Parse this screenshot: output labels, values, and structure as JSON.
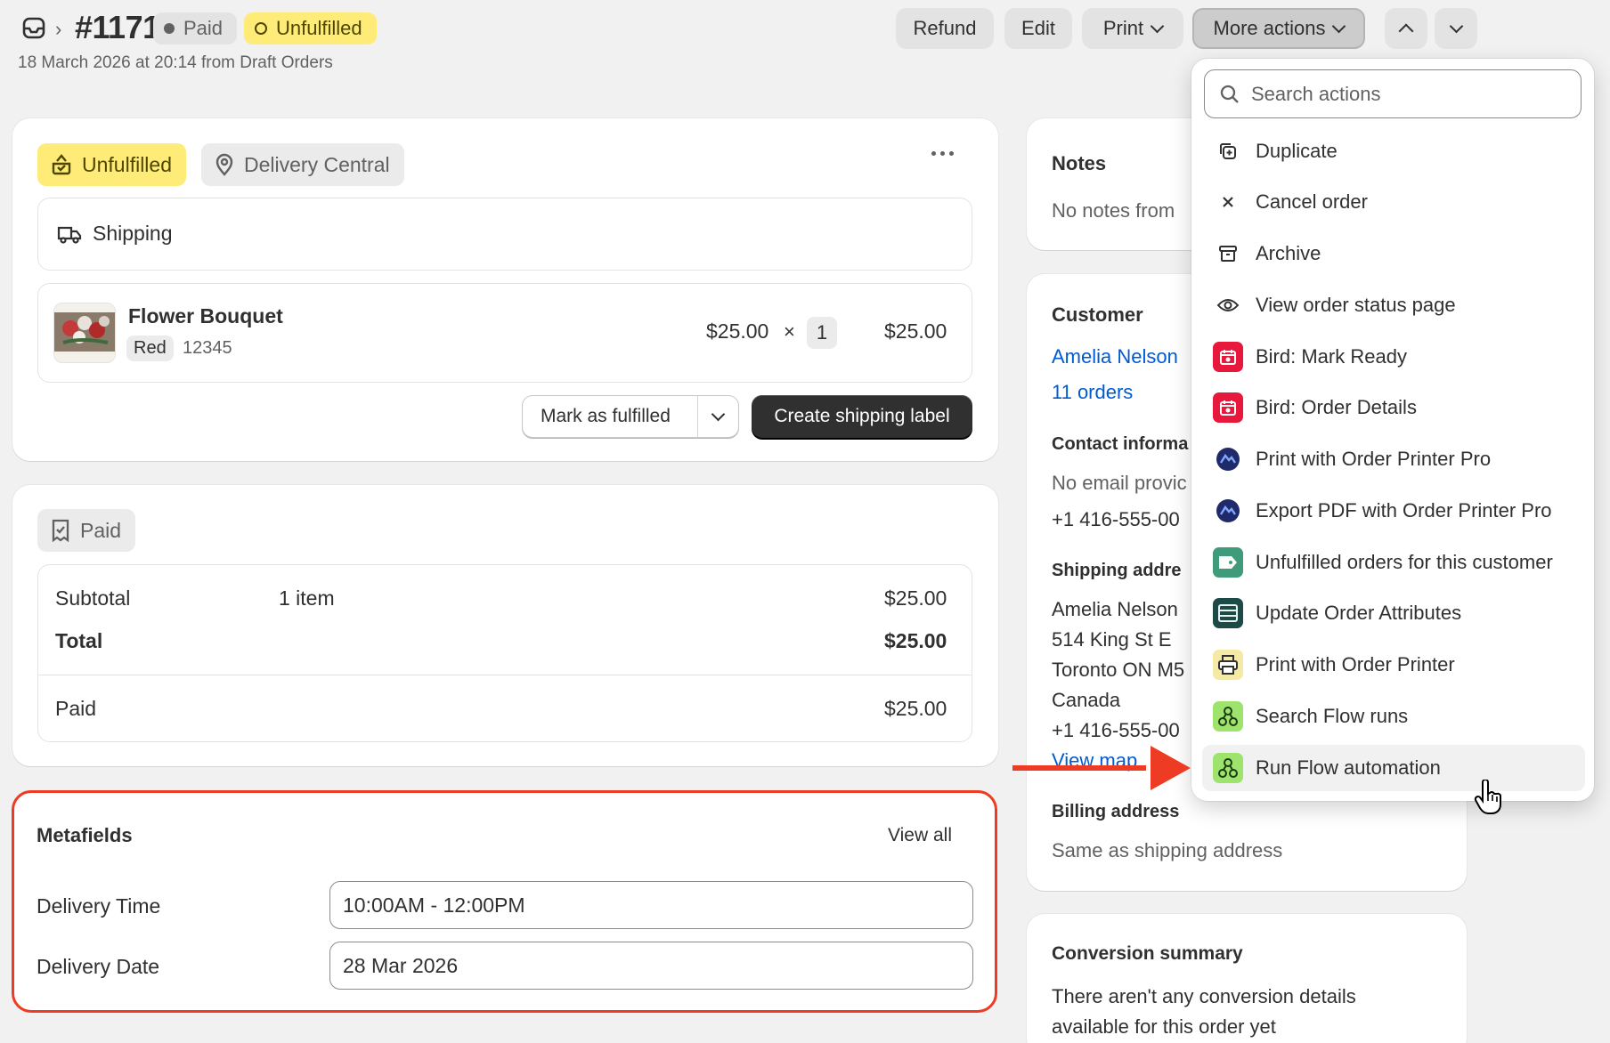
{
  "header": {
    "order_number": "#1171",
    "paid_badge": "Paid",
    "unfulfilled_badge": "Unfulfilled",
    "subline": "18 March 2026 at 20:14 from Draft Orders",
    "buttons": {
      "refund": "Refund",
      "edit": "Edit",
      "print": "Print",
      "more_actions": "More actions"
    }
  },
  "fulfillment": {
    "status": "Unfulfilled",
    "location": "Delivery Central",
    "method": "Shipping",
    "item": {
      "name": "Flower Bouquet",
      "variant": "Red",
      "sku": "12345",
      "unit_price": "$25.00",
      "times": "×",
      "quantity": "1",
      "total": "$25.00"
    },
    "mark_fulfilled": "Mark as fulfilled",
    "create_label": "Create shipping label"
  },
  "payment": {
    "status": "Paid",
    "subtotal_label": "Subtotal",
    "subtotal_items": "1 item",
    "subtotal_value": "$25.00",
    "total_label": "Total",
    "total_value": "$25.00",
    "paid_label": "Paid",
    "paid_value": "$25.00"
  },
  "metafields": {
    "title": "Metafields",
    "view_all": "View all",
    "delivery_time_label": "Delivery Time",
    "delivery_time_value": "10:00AM - 12:00PM",
    "delivery_date_label": "Delivery Date",
    "delivery_date_value": "28 Mar 2026"
  },
  "notes": {
    "title": "Notes",
    "text": "No notes from"
  },
  "customer": {
    "title": "Customer",
    "name": "Amelia Nelson",
    "orders": "11 orders",
    "contact_title": "Contact informa",
    "email": "No email provic",
    "phone": "+1 416-555-00",
    "shipping_title": "Shipping addre",
    "address_lines": [
      "Amelia Nelson",
      "514 King St E",
      "Toronto ON M5",
      "Canada",
      "+1 416-555-00"
    ],
    "view_map": "View map",
    "billing_title": "Billing address",
    "billing_text": "Same as shipping address"
  },
  "conversion": {
    "title": "Conversion summary",
    "line1": "There aren't any conversion details",
    "line2": "available for this order yet"
  },
  "menu": {
    "search_placeholder": "Search actions",
    "items": [
      {
        "label": "Duplicate",
        "icon": "duplicate-icon"
      },
      {
        "label": "Cancel order",
        "icon": "close-icon"
      },
      {
        "label": "Archive",
        "icon": "archive-icon"
      },
      {
        "label": "View order status page",
        "icon": "eye-icon"
      },
      {
        "label": "Bird: Mark Ready",
        "icon": "bird-app-icon"
      },
      {
        "label": "Bird: Order Details",
        "icon": "bird-app-icon"
      },
      {
        "label": "Print with Order Printer Pro",
        "icon": "order-printer-pro-icon"
      },
      {
        "label": "Export PDF with Order Printer Pro",
        "icon": "order-printer-pro-icon"
      },
      {
        "label": "Unfulfilled orders for this customer",
        "icon": "tag-app-icon"
      },
      {
        "label": "Update Order Attributes",
        "icon": "attributes-app-icon"
      },
      {
        "label": "Print with Order Printer",
        "icon": "printer-app-icon"
      },
      {
        "label": "Search Flow runs",
        "icon": "flow-icon"
      },
      {
        "label": "Run Flow automation",
        "icon": "flow-icon"
      }
    ]
  },
  "colors": {
    "highlight": "#ee3b23",
    "unfulfilled_bg": "#ffeb78",
    "link": "#005bd3",
    "primary_button": "#303030"
  }
}
